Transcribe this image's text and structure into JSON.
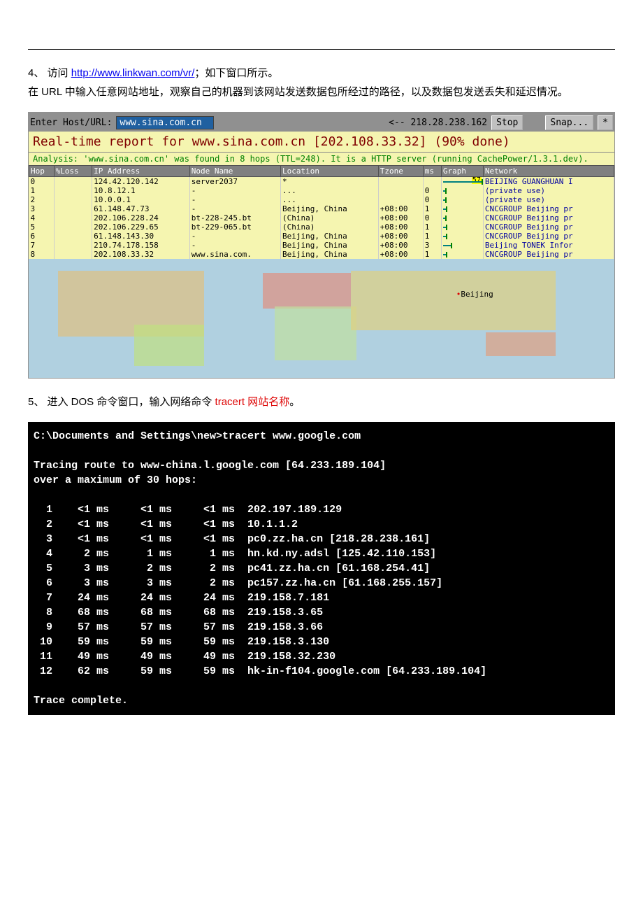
{
  "step4": {
    "prefix": "4、 访问 ",
    "link_text": "http://www.linkwan.com/vr/",
    "link_href": "http://www.linkwan.com/vr/",
    "suffix": "；如下窗口所示。",
    "line2": "在 URL 中输入任意网站地址，观察自己的机器到该网站发送数据包所经过的路径，以及数据包发送丢失和延迟情况。"
  },
  "vr": {
    "host_label": "Enter Host/URL:",
    "host_value": "www.sina.com.cn",
    "arrow_ip": "<-- 218.28.238.162",
    "stop": "Stop",
    "snap": "Snap...",
    "title": "Real-time report for www.sina.com.cn [202.108.33.32] (90% done)",
    "analysis_pre": "Analysis: ",
    "analysis_host": "'www.sina.com.cn'",
    "analysis_mid": " was found in 8 hops (TTL=248). It is a HTTP server (running CachePower/1.3.1.dev).",
    "headers": [
      "Hop",
      "%Loss",
      "IP Address",
      "Node Name",
      "Location",
      "Tzone",
      "ms",
      "Graph",
      "Network"
    ],
    "rows": [
      {
        "hop": "0",
        "loss": "",
        "ip": "124.42.120.142",
        "node": "server2037",
        "loc": "*",
        "tz": "",
        "ms": "",
        "gms": "57",
        "gw": "100",
        "net": "BEIJING GUANGHUAN I"
      },
      {
        "hop": "1",
        "loss": "",
        "ip": "10.8.12.1",
        "node": "-",
        "loc": "...",
        "tz": "",
        "ms": "0",
        "gms": "",
        "gw": "5",
        "net": "(private use)"
      },
      {
        "hop": "2",
        "loss": "",
        "ip": "10.0.0.1",
        "node": "-",
        "loc": "...",
        "tz": "",
        "ms": "0",
        "gms": "",
        "gw": "5",
        "net": "(private use)"
      },
      {
        "hop": "3",
        "loss": "",
        "ip": "61.148.47.73",
        "node": "-",
        "loc": "Beijing, China",
        "tz": "+08:00",
        "ms": "1",
        "gms": "",
        "gw": "8",
        "net": "CNCGROUP Beijing pr"
      },
      {
        "hop": "4",
        "loss": "",
        "ip": "202.106.228.24",
        "node": "bt-228-245.bt",
        "loc": "(China)",
        "tz": "+08:00",
        "ms": "0",
        "gms": "",
        "gw": "5",
        "net": "CNCGROUP Beijing pr"
      },
      {
        "hop": "5",
        "loss": "",
        "ip": "202.106.229.65",
        "node": "bt-229-065.bt",
        "loc": "(China)",
        "tz": "+08:00",
        "ms": "1",
        "gms": "",
        "gw": "8",
        "net": "CNCGROUP Beijing pr"
      },
      {
        "hop": "6",
        "loss": "",
        "ip": "61.148.143.30",
        "node": "-",
        "loc": "Beijing, China",
        "tz": "+08:00",
        "ms": "1",
        "gms": "",
        "gw": "8",
        "net": "CNCGROUP Beijing pr"
      },
      {
        "hop": "7",
        "loss": "",
        "ip": "210.74.178.158",
        "node": "-",
        "loc": "Beijing, China",
        "tz": "+08:00",
        "ms": "3",
        "gms": "",
        "gw": "20",
        "net": "Beijing TONEK Infor"
      },
      {
        "hop": "8",
        "loss": "",
        "ip": "202.108.33.32",
        "node": "www.sina.com.",
        "loc": "Beijing, China",
        "tz": "+08:00",
        "ms": "1",
        "gms": "",
        "gw": "8",
        "net": "CNCGROUP Beijing pr"
      }
    ],
    "map_marker": "Beijing"
  },
  "step5": {
    "prefix": "5、 进入 DOS 命令窗口，输入网络命令 ",
    "cmd": "tracert 网站名称",
    "suffix": "。"
  },
  "dos": {
    "cmdline": "C:\\Documents and Settings\\new>tracert www.google.com",
    "tracing": "Tracing route to www-china.l.google.com [64.233.189.104]\nover a maximum of 30 hops:",
    "rows": [
      {
        "n": " 1",
        "a": "  <1 ms",
        "b": "   <1 ms",
        "c": "   <1 ms",
        "h": "202.197.189.129"
      },
      {
        "n": " 2",
        "a": "  <1 ms",
        "b": "   <1 ms",
        "c": "   <1 ms",
        "h": "10.1.1.2"
      },
      {
        "n": " 3",
        "a": "  <1 ms",
        "b": "   <1 ms",
        "c": "   <1 ms",
        "h": "pc0.zz.ha.cn [218.28.238.161]"
      },
      {
        "n": " 4",
        "a": "   2 ms",
        "b": "    1 ms",
        "c": "    1 ms",
        "h": "hn.kd.ny.adsl [125.42.110.153]"
      },
      {
        "n": " 5",
        "a": "   3 ms",
        "b": "    2 ms",
        "c": "    2 ms",
        "h": "pc41.zz.ha.cn [61.168.254.41]"
      },
      {
        "n": " 6",
        "a": "   3 ms",
        "b": "    3 ms",
        "c": "    2 ms",
        "h": "pc157.zz.ha.cn [61.168.255.157]"
      },
      {
        "n": " 7",
        "a": "  24 ms",
        "b": "   24 ms",
        "c": "   24 ms",
        "h": "219.158.7.181"
      },
      {
        "n": " 8",
        "a": "  68 ms",
        "b": "   68 ms",
        "c": "   68 ms",
        "h": "219.158.3.65"
      },
      {
        "n": " 9",
        "a": "  57 ms",
        "b": "   57 ms",
        "c": "   57 ms",
        "h": "219.158.3.66"
      },
      {
        "n": "10",
        "a": "  59 ms",
        "b": "   59 ms",
        "c": "   59 ms",
        "h": "219.158.3.130"
      },
      {
        "n": "11",
        "a": "  49 ms",
        "b": "   49 ms",
        "c": "   49 ms",
        "h": "219.158.32.230"
      },
      {
        "n": "12",
        "a": "  62 ms",
        "b": "   59 ms",
        "c": "   59 ms",
        "h": "hk-in-f104.google.com [64.233.189.104]"
      }
    ],
    "complete": "Trace complete."
  }
}
